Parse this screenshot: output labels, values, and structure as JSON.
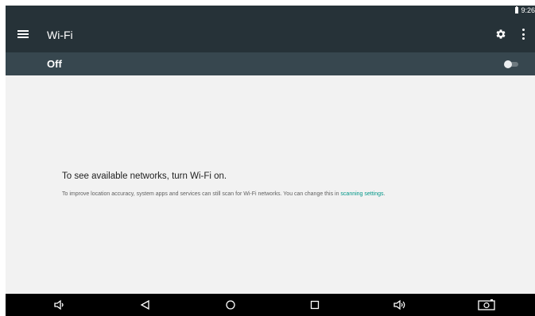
{
  "status_bar": {
    "time": "9:26",
    "icons": [
      "battery-icon"
    ]
  },
  "app_bar": {
    "title": "Wi-Fi",
    "icons": [
      "menu-icon",
      "gear-icon",
      "more-vert-icon"
    ]
  },
  "switch_bar": {
    "label": "Off",
    "toggle_state": "off"
  },
  "empty_state": {
    "headline": "To see available networks, turn Wi-Fi on.",
    "description": "To improve location accuracy, system apps and services can still scan for Wi-Fi networks. You can change this in ",
    "link_label": "scanning settings",
    "description_end": "."
  },
  "nav_bar": {
    "icons": [
      "volume-down-icon",
      "back-icon",
      "home-icon",
      "recents-icon",
      "volume-up-icon",
      "screenshot-icon"
    ]
  },
  "colors": {
    "app_bar": "#263238",
    "switch_bar": "#37474f",
    "link": "#009688",
    "background": "#f2f2f2"
  }
}
